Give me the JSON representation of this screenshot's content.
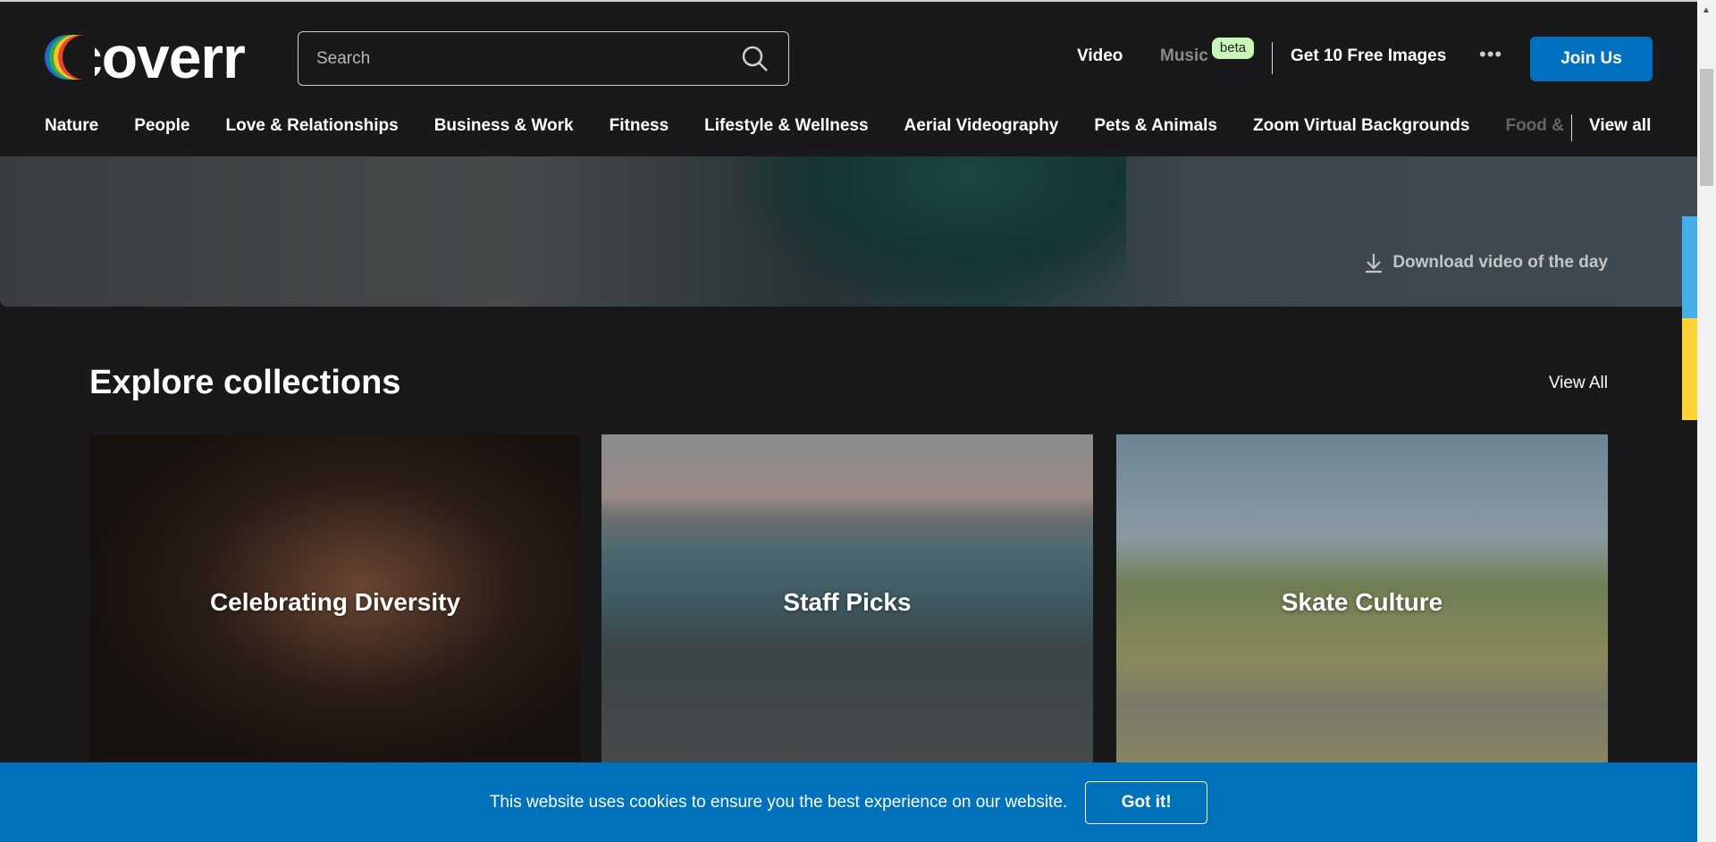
{
  "header": {
    "logo": "coverr",
    "search": {
      "placeholder": "Search",
      "value": ""
    },
    "nav": {
      "video": "Video",
      "music": "Music",
      "beta": "beta",
      "free_images": "Get 10 Free Images",
      "more": "•••",
      "join": "Join Us"
    },
    "categories": [
      "Nature",
      "People",
      "Love & Relationships",
      "Business & Work",
      "Fitness",
      "Lifestyle & Wellness",
      "Aerial Videography",
      "Pets & Animals",
      "Zoom Virtual Backgrounds",
      "Food &"
    ],
    "view_all": "View all"
  },
  "hero": {
    "download": "Download video of the day"
  },
  "collections": {
    "title": "Explore collections",
    "view_all": "View All",
    "items": [
      "Celebrating Diversity",
      "Staff Picks",
      "Skate Culture"
    ]
  },
  "cookie": {
    "text": "This website uses cookies to ensure you the best experience on our website.",
    "button": "Got it!"
  },
  "colors": {
    "brand_blue": "#0070c0",
    "beta_bg": "#c8f5b8",
    "stripe_blue": "#45b0e8",
    "stripe_yellow": "#ffd335"
  }
}
